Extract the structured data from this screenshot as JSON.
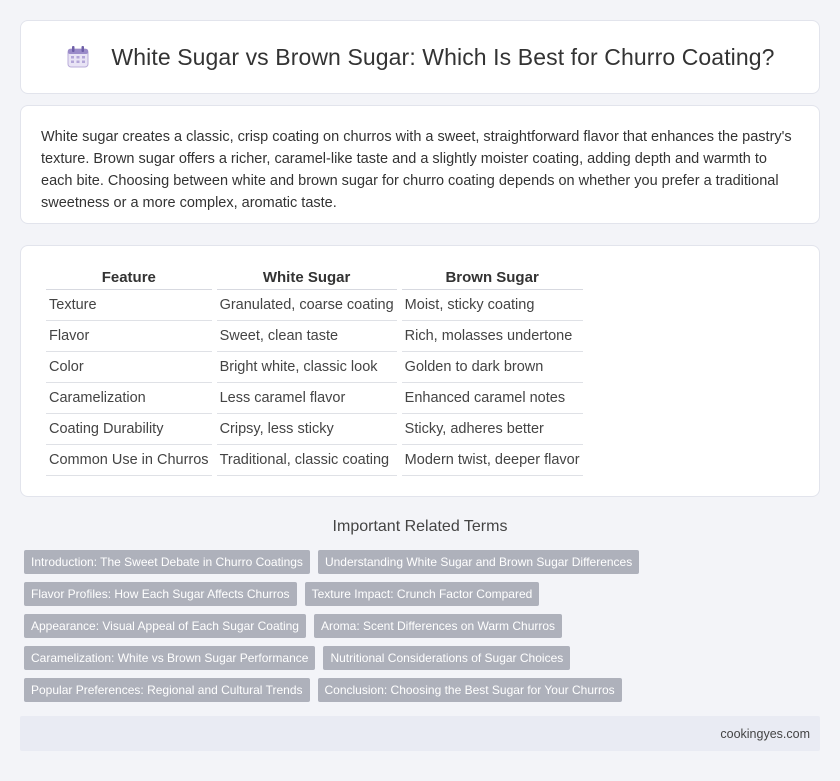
{
  "header": {
    "icon": "calendar-icon",
    "title": "White Sugar vs Brown Sugar: Which Is Best for Churro Coating?"
  },
  "intro": {
    "text": "White sugar creates a classic, crisp coating on churros with a sweet, straightforward flavor that enhances the pastry's texture. Brown sugar offers a richer, caramel-like taste and a slightly moister coating, adding depth and warmth to each bite. Choosing between white and brown sugar for churro coating depends on whether you prefer a traditional sweetness or a more complex, aromatic taste."
  },
  "comparison": {
    "headers": [
      "Feature",
      "White Sugar",
      "Brown Sugar"
    ],
    "rows": [
      [
        "Texture",
        "Granulated, coarse coating",
        "Moist, sticky coating"
      ],
      [
        "Flavor",
        "Sweet, clean taste",
        "Rich, molasses undertone"
      ],
      [
        "Color",
        "Bright white, classic look",
        "Golden to dark brown"
      ],
      [
        "Caramelization",
        "Less caramel flavor",
        "Enhanced caramel notes"
      ],
      [
        "Coating Durability",
        "Cripsy, less sticky",
        "Sticky, adheres better"
      ],
      [
        "Common Use in Churros",
        "Traditional, classic coating",
        "Modern twist, deeper flavor"
      ]
    ]
  },
  "related": {
    "title": "Important Related Terms",
    "tags": [
      [
        "Introduction: The Sweet Debate in Churro Coatings",
        "Understanding White Sugar and Brown Sugar Differences"
      ],
      [
        "Flavor Profiles: How Each Sugar Affects Churros",
        "Texture Impact: Crunch Factor Compared"
      ],
      [
        "Appearance: Visual Appeal of Each Sugar Coating",
        "Aroma: Scent Differences on Warm Churros"
      ],
      [
        "Caramelization: White vs Brown Sugar Performance",
        "Nutritional Considerations of Sugar Choices"
      ],
      [
        "Popular Preferences: Regional and Cultural Trends",
        "Conclusion: Choosing the Best Sugar for Your Churros"
      ]
    ]
  },
  "footer": {
    "site": "cookingyes.com"
  },
  "colors": {
    "tag_bg": "#aeb1bb",
    "page_bg": "#f3f4f8",
    "footer_bg": "#e9ebf3"
  }
}
